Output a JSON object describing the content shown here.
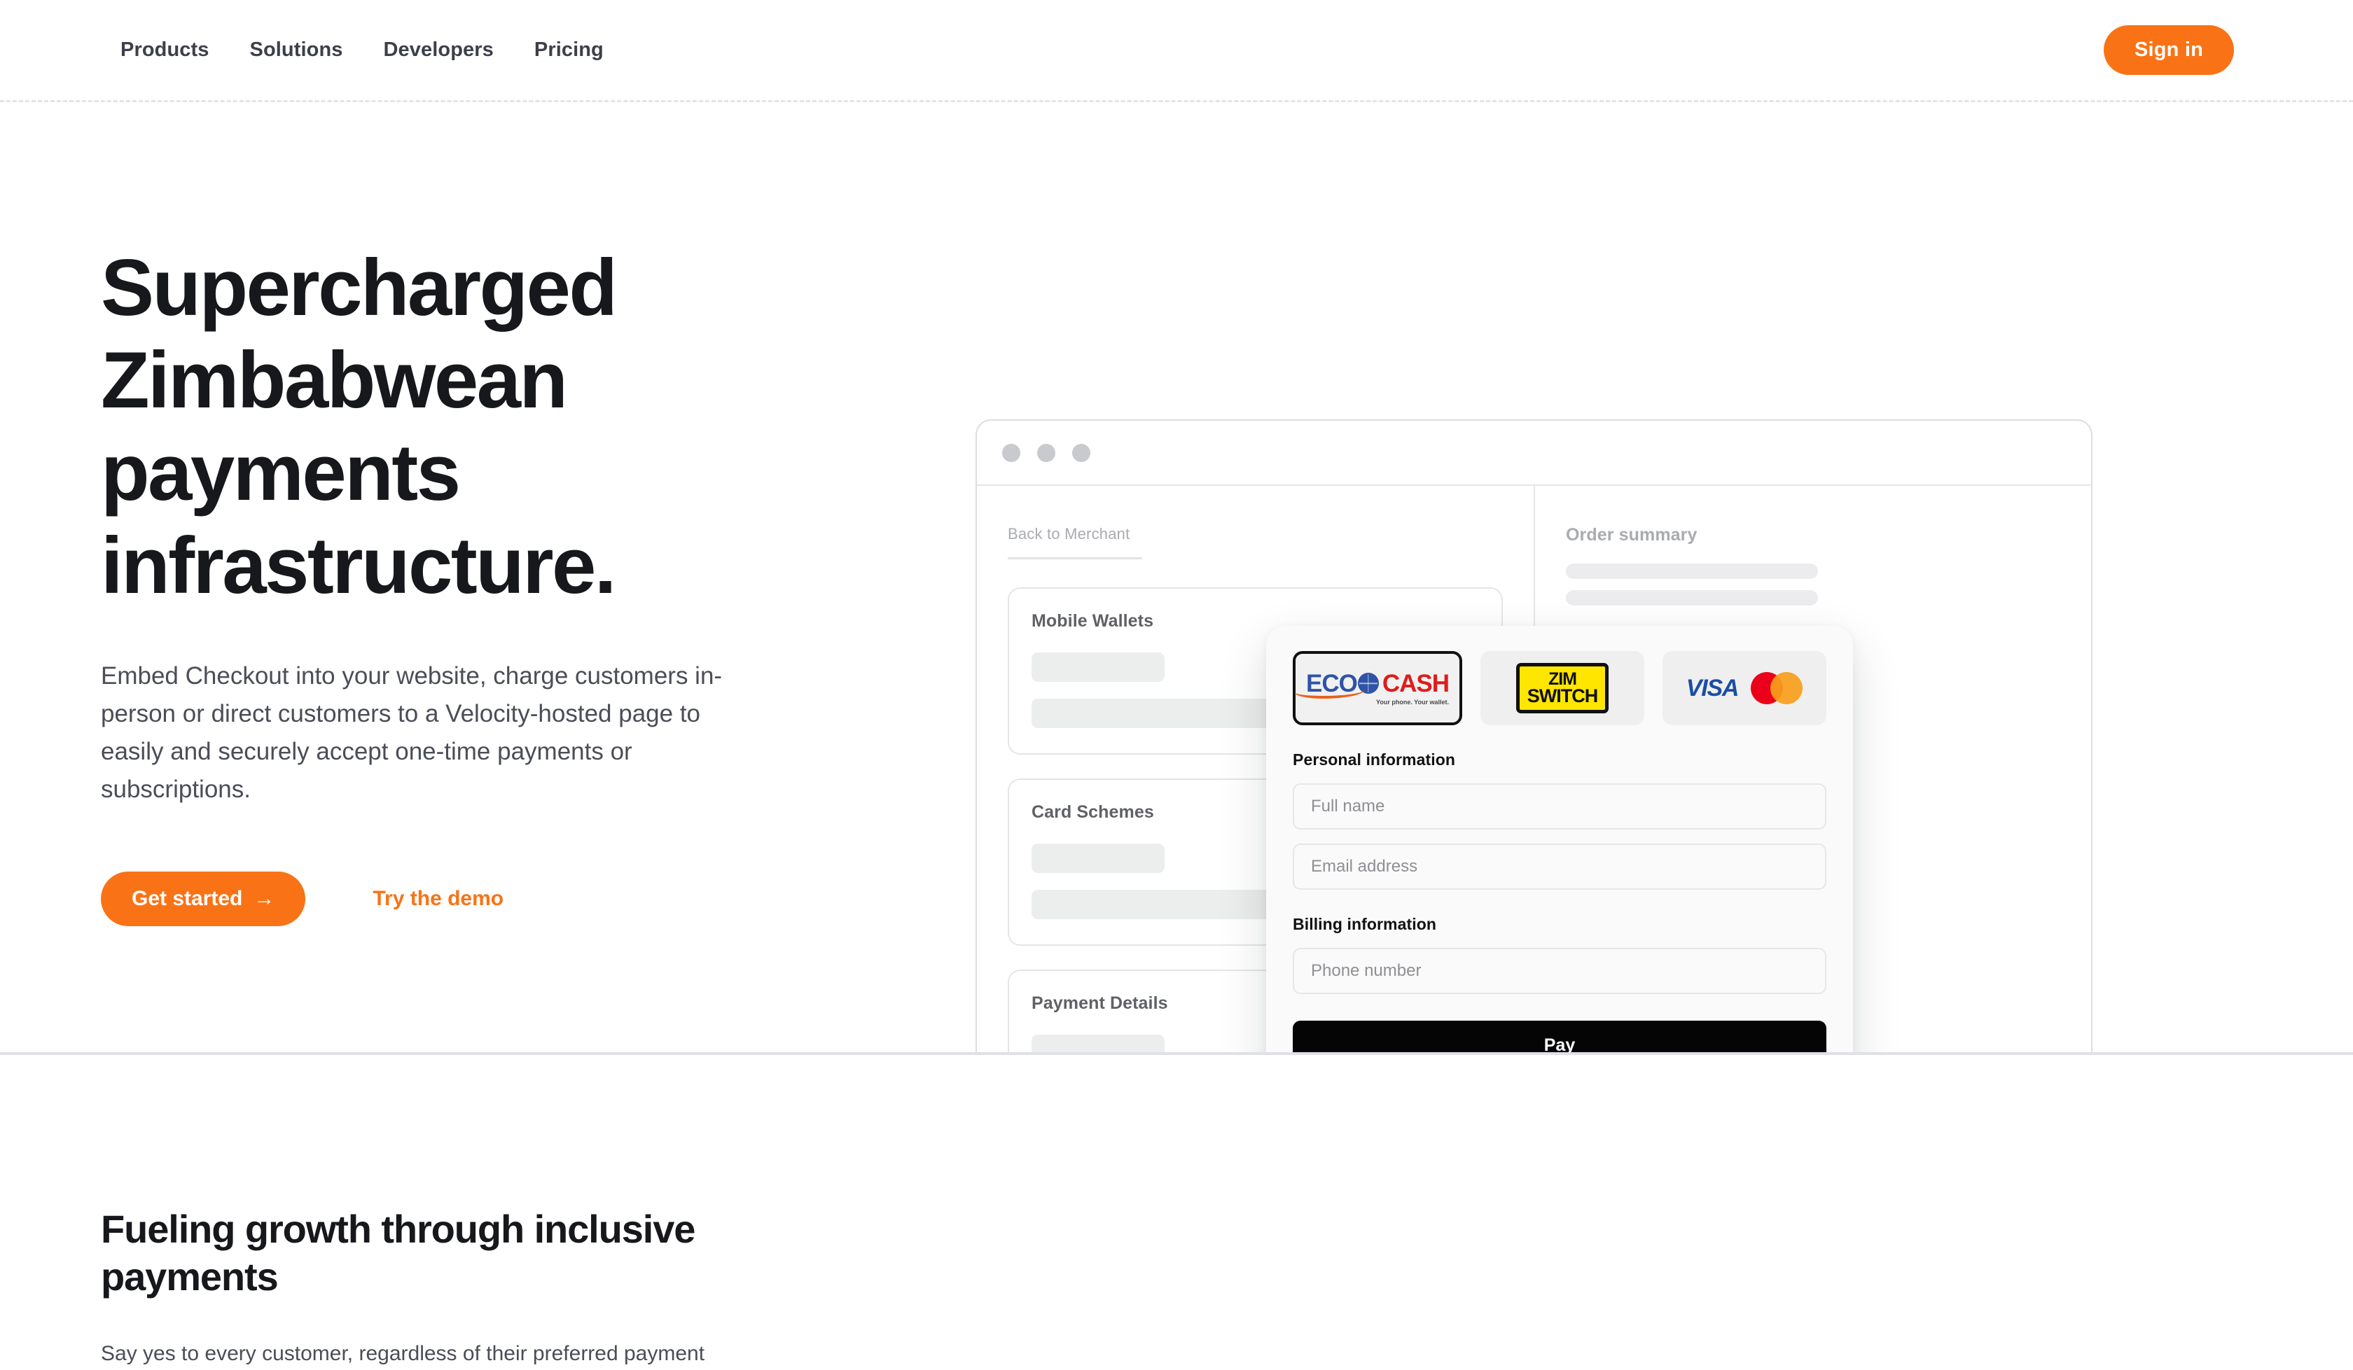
{
  "nav": {
    "links": [
      {
        "label": "Products"
      },
      {
        "label": "Solutions"
      },
      {
        "label": "Developers"
      },
      {
        "label": "Pricing"
      }
    ],
    "signin_label": "Sign in",
    "accent_color": "#f97316"
  },
  "hero": {
    "title": "Supercharged Zimbabwean payments infrastructure.",
    "subtitle": "Embed Checkout into your website, charge customers in-person or direct customers to a Velocity-hosted page to easily and securely accept one-time payments or subscriptions.",
    "primary_cta": "Get started",
    "primary_cta_arrow": "→",
    "secondary_cta": "Try the demo"
  },
  "mockup": {
    "back_link": "Back to Merchant",
    "sections": [
      {
        "title": "Mobile Wallets"
      },
      {
        "title": "Card Schemes"
      },
      {
        "title": "Payment Details"
      }
    ],
    "order_summary_title": "Order summary"
  },
  "checkout": {
    "methods": [
      {
        "name": "ecocash",
        "word1": "ECO",
        "word2": "CASH",
        "tagline": "Your phone. Your wallet.",
        "selected": true
      },
      {
        "name": "zimswitch",
        "line1": "ZIM",
        "line2": "SWITCH",
        "selected": false
      },
      {
        "name": "visa-mastercard",
        "visa": "VISA",
        "selected": false
      }
    ],
    "personal_label": "Personal information",
    "full_name_placeholder": "Full name",
    "email_placeholder": "Email address",
    "full_name_value": "",
    "email_value": "",
    "billing_label": "Billing information",
    "phone_placeholder": "Phone number",
    "phone_value": "",
    "pay_label": "Pay"
  },
  "section2": {
    "title": "Fueling growth through inclusive payments",
    "subtitle": "Say yes to every customer, regardless of their preferred payment"
  }
}
